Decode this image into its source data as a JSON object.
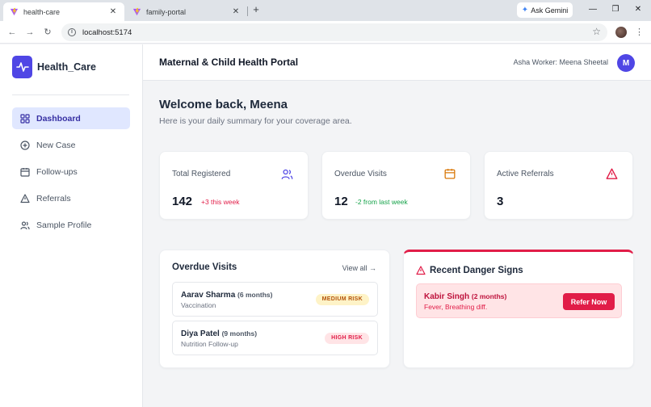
{
  "browser": {
    "tabs": [
      {
        "title": "health-care",
        "active": true
      },
      {
        "title": "family-portal",
        "active": false
      }
    ],
    "new_tab": "+",
    "gemini_label": "Ask Gemini",
    "url": "localhost:5174"
  },
  "sidebar": {
    "brand": "Health_Care",
    "items": [
      {
        "label": "Dashboard",
        "icon": "grid-icon",
        "active": true
      },
      {
        "label": "New Case",
        "icon": "plus-circle-icon",
        "active": false
      },
      {
        "label": "Follow-ups",
        "icon": "calendar-icon",
        "active": false
      },
      {
        "label": "Referrals",
        "icon": "warning-icon",
        "active": false
      },
      {
        "label": "Sample Profile",
        "icon": "users-icon",
        "active": false
      }
    ]
  },
  "header": {
    "title": "Maternal & Child Health Portal",
    "worker": "Asha Worker: Meena Sheetal",
    "avatar_initial": "M"
  },
  "main": {
    "welcome": "Welcome back, Meena",
    "subtitle": "Here is your daily summary for your coverage area.",
    "stats": [
      {
        "label": "Total Registered",
        "value": "142",
        "delta": "+3 this week",
        "icon": "users-icon",
        "color": "#4f46e5",
        "delta_color": "#e11d48"
      },
      {
        "label": "Overdue Visits",
        "value": "12",
        "delta": "-2 from last week",
        "icon": "calendar-icon",
        "color": "#d97706",
        "delta_color": "#16a34a"
      },
      {
        "label": "Active Referrals",
        "value": "3",
        "delta": "",
        "icon": "warning-icon",
        "color": "#e11d48",
        "delta_color": ""
      }
    ],
    "overdue": {
      "title": "Overdue Visits",
      "view_all": "View all",
      "items": [
        {
          "name": "Aarav Sharma",
          "age": "(6 months)",
          "type": "Vaccination",
          "risk": "MEDIUM RISK",
          "risk_bg": "#fef3c7",
          "risk_color": "#b45309"
        },
        {
          "name": "Diya Patel",
          "age": "(9 months)",
          "type": "Nutrition Follow-up",
          "risk": "HIGH RISK",
          "risk_bg": "#ffe4e6",
          "risk_color": "#e11d48"
        }
      ]
    },
    "danger": {
      "title": "Recent Danger Signs",
      "items": [
        {
          "name": "Kabir Singh",
          "age": "(2 months)",
          "signs": "Fever, Breathing diff.",
          "action": "Refer Now"
        }
      ]
    }
  },
  "colors": {
    "accent": "#4f46e5",
    "danger": "#e11d48",
    "warning": "#d97706",
    "success": "#16a34a"
  }
}
